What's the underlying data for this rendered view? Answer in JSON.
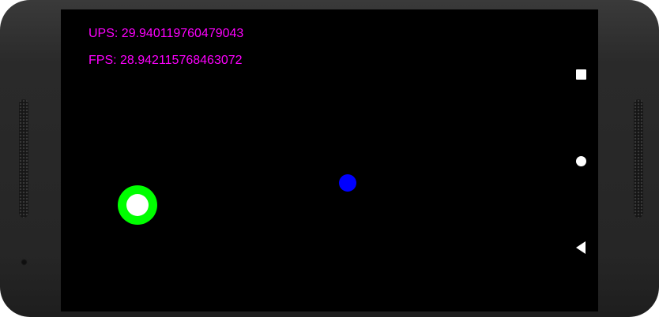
{
  "hud": {
    "ups_text": "UPS: 29.940119760479043",
    "fps_text": "FPS: 28.942115768463072"
  },
  "colors": {
    "hud_text": "#ff00ff",
    "joystick_outer": "#00ff00",
    "joystick_inner": "#ffffff",
    "player": "#0000ff",
    "screen_background": "#000000"
  },
  "navigation": {
    "icons": [
      "recents-square-icon",
      "home-circle-icon",
      "back-triangle-icon"
    ]
  }
}
